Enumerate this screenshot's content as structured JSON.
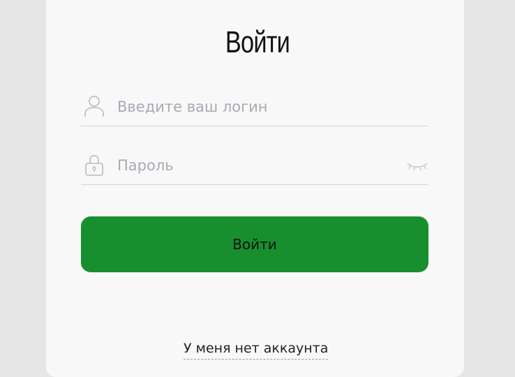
{
  "form": {
    "title": "Войти",
    "login": {
      "placeholder": "Введите ваш логин",
      "value": "",
      "icon": "user-icon"
    },
    "password": {
      "placeholder": "Пароль",
      "value": "",
      "icon": "lock-icon",
      "toggle_icon": "eye-closed-icon"
    },
    "submit_label": "Войти",
    "no_account_link": "У меня нет аккаунта"
  },
  "colors": {
    "background": "#e6e6e6",
    "card": "#f8f8f8",
    "accent": "#178f2e",
    "placeholder": "#a9a9b4"
  }
}
